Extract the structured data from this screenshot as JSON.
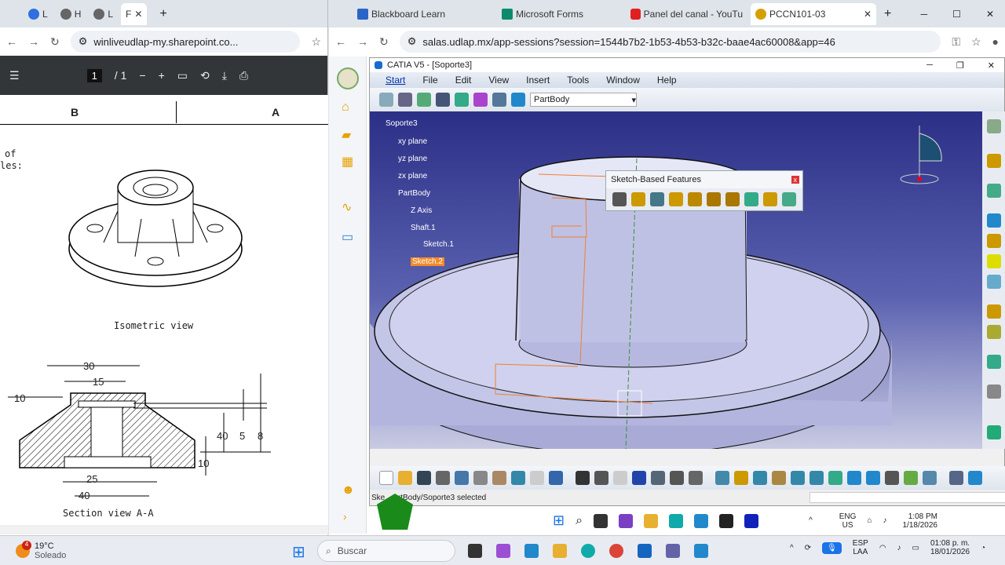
{
  "left_browser": {
    "tabs": [
      {
        "label": "L",
        "color": "#2f6fe0"
      },
      {
        "label": "H",
        "color": "#444"
      },
      {
        "label": "L",
        "color": "#444"
      },
      {
        "label": "F",
        "color": "#cc3333"
      }
    ],
    "url": "winliveudlap-my.sharepoint.co...",
    "pdf": {
      "page": "1",
      "total": "/ 1"
    },
    "drawing": {
      "col_b": "B",
      "col_a": "A",
      "side_text_1": "of",
      "side_text_2": "les:",
      "iso_caption": "Isometric view",
      "section_caption": "Section view A-A",
      "dims": {
        "d30": "30",
        "d15": "15",
        "d10a": "10",
        "d40v": "40",
        "d5": "5",
        "d8": "8",
        "d10b": "10",
        "d25": "25",
        "d40h": "40"
      }
    }
  },
  "right_browser": {
    "tabs": [
      {
        "label": "Blackboard Learn",
        "color": "#2a64c8"
      },
      {
        "label": "Microsoft Forms",
        "color": "#0b8a6c"
      },
      {
        "label": "Panel del canal - YouTu",
        "color": "#e02020"
      },
      {
        "label": "PCCN101-03",
        "color": "#d4a000"
      }
    ],
    "url": "salas.udlap.mx/app-sessions?session=1544b7b2-1b53-4b53-b32c-baae4ac60008&app=46"
  },
  "catia": {
    "title": "CATIA V5 - [Soporte3]",
    "menu": [
      "Start",
      "File",
      "Edit",
      "View",
      "Insert",
      "Tools",
      "Window",
      "Help"
    ],
    "workbench": "PartBody",
    "tree": [
      "Soporte3",
      "xy plane",
      "yz plane",
      "zx plane",
      "PartBody",
      "Z Axis",
      "Shaft.1",
      "Sketch.1",
      "Sketch.2"
    ],
    "toolbar_title": "Sketch-Based Features",
    "status": "Ske... artBody/Soporte3 selected",
    "remote_taskbar": {
      "lang": "ENG",
      "region": "US",
      "time": "1:08 PM",
      "date": "1/18/2026"
    }
  },
  "taskbar": {
    "temp": "19°C",
    "weather": "Soleado",
    "search": "Buscar",
    "lang": "ESP",
    "region": "LAA",
    "time": "01:08 p. m.",
    "date": "18/01/2026",
    "badge": "4"
  }
}
